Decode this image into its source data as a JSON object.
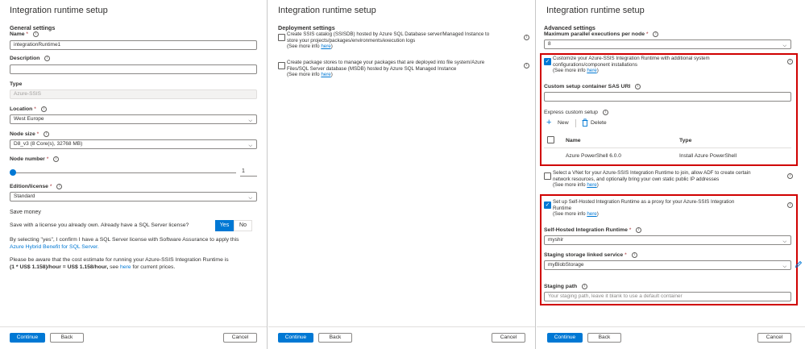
{
  "panel1": {
    "title": "Integration runtime setup",
    "general_heading": "General settings",
    "name_label": "Name",
    "name_required": "*",
    "name_value": "integrationRuntime1",
    "description_label": "Description",
    "description_value": "",
    "type_label": "Type",
    "type_value": "Azure-SSIS",
    "location_label": "Location",
    "location_required": "*",
    "location_value": "West Europe",
    "node_size_label": "Node size",
    "node_size_required": "*",
    "node_size_value": "D8_v3 (8 Core(s), 32768 MB)",
    "node_number_label": "Node number",
    "node_number_required": "*",
    "node_number_value": "1",
    "node_number_fraction": 0,
    "edition_label": "Edition/license",
    "edition_required": "*",
    "edition_value": "Standard",
    "save_money": "Save money",
    "license_question": "Save with a license you already own. Already have a SQL Server license?",
    "yes_label": "Yes",
    "no_label": "No",
    "confirm_text": "By selecting \"yes\", I confirm I have a SQL Server license with Software Assurance to apply this",
    "hybrid_link": "Azure Hybrid Benefit for SQL Server.",
    "cost_text1": "Please be aware that the cost estimate for running your Azure-SSIS Integration Runtime is",
    "cost_bold": "(1 * US$ 1.158)/hour = US$ 1.158/hour,",
    "cost_see": " see ",
    "cost_here": "here",
    "cost_tail": " for current prices."
  },
  "panel2": {
    "title": "Integration runtime setup",
    "deploy_heading": "Deployment settings",
    "opt1_line1": "Create SSIS catalog (SSISDB) hosted by Azure SQL Database server/Managed Instance to",
    "opt1_line2": "store your projects/packages/environments/execution logs",
    "opt2_line1": "Create package stores to manage your packages that are deployed into file system/Azure",
    "opt2_line2": "Files/SQL Server database (MSDB) hosted by Azure SQL Managed Instance",
    "see_more": "(See more info ",
    "here": "here",
    "close_paren": ")"
  },
  "panel3": {
    "title": "Integration runtime setup",
    "adv_heading": "Advanced settings",
    "max_parallel_label": "Maximum parallel executions per node",
    "max_parallel_required": "*",
    "max_parallel_value": "8",
    "custom_line1": "Customize your Azure-SSIS Integration Runtime with additional system",
    "custom_line2": "configurations/component installations",
    "sas_label": "Custom setup container SAS URI",
    "sas_value": "",
    "express_label": "Express custom setup",
    "new_label": "New",
    "delete_label": "Delete",
    "col_name": "Name",
    "col_type": "Type",
    "rows": [
      {
        "name": "Azure PowerShell 6.0.0",
        "type": "Install Azure PowerShell"
      }
    ],
    "vnet_line1": "Select a VNet for your Azure-SSIS Integration Runtime to join, allow ADF to create certain",
    "vnet_line2": "network resources, and optionally bring your own static public IP addresses",
    "proxy_line1": "Set up Self-Hosted Integration Runtime as a proxy for your Azure-SSIS Integration",
    "proxy_line2": "Runtime",
    "shir_label": "Self-Hosted Integration Runtime",
    "shir_required": "*",
    "shir_value": "myshir",
    "staging_label": "Staging storage linked service",
    "staging_required": "*",
    "staging_value": "myBlobStorage",
    "path_label": "Staging path",
    "path_placeholder": "Your staging path, leave it blank to use a default container",
    "see_more": "(See more info ",
    "here": "here",
    "close_paren": ")"
  },
  "footer": {
    "continue": "Continue",
    "back": "Back",
    "cancel": "Cancel"
  },
  "colors": {
    "accent": "#0078d4",
    "highlight_border": "#d00000"
  },
  "icons": {
    "info": "info-icon",
    "chevron": "chevron-down-icon",
    "add": "plus-icon",
    "delete": "trash-icon",
    "edit": "pencil-icon",
    "check": "checkmark-icon"
  }
}
